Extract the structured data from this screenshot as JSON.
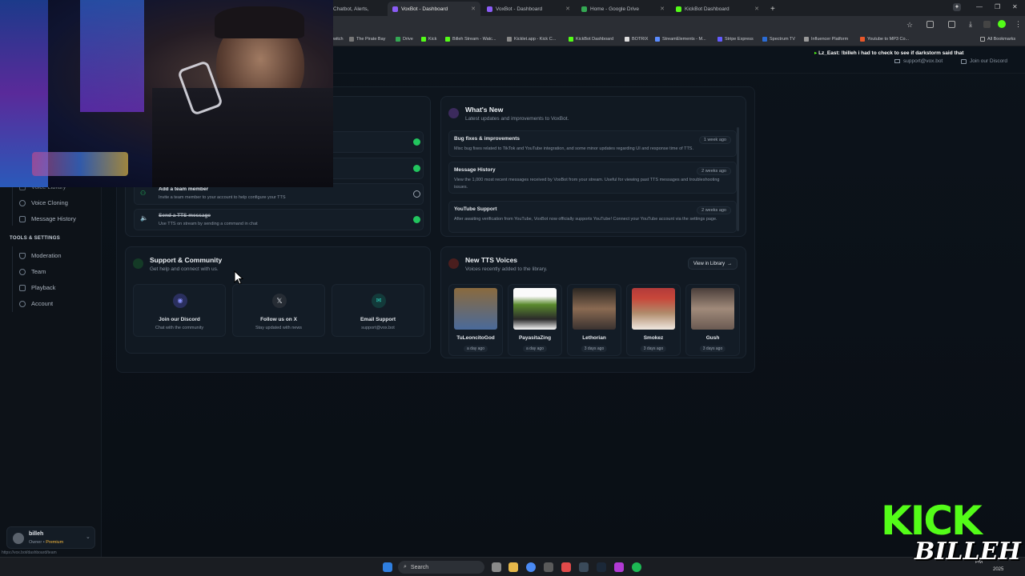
{
  "browser": {
    "tabs": [
      {
        "label": "Chatbot, Alerts,",
        "active": false
      },
      {
        "label": "VoxBot - Dashboard",
        "active": true
      },
      {
        "label": "VoxBot - Dashboard",
        "active": false
      },
      {
        "label": "Home - Google Drive",
        "active": false
      },
      {
        "label": "KickBot Dashboard",
        "active": false
      }
    ],
    "new_tab": "+",
    "bookmarks": [
      "witch",
      "The Pirate Bay",
      "Drive",
      "Kick",
      "Billeh Stream - Watc...",
      "Kicklet.app - Kick C...",
      "KickBot Dashboard",
      "BOTRIX",
      "StreamElements - M...",
      "Stripe Express",
      "Spectrum TV",
      "Influencer Platform",
      "Youtube to MP3 Co..."
    ],
    "all_bookmarks": "All Bookmarks"
  },
  "topbar": {
    "chat_user": "Lz_East",
    "chat_message": ": !billeh i had to check to see if darkstorm said that",
    "support_email": "support@vox.bot",
    "discord_link": "Join our Discord"
  },
  "sidebar": {
    "partial_item": "Voice Library",
    "items_top": [
      {
        "label": "Voice Cloning",
        "icon": "voice-clone-icon"
      },
      {
        "label": "Message History",
        "icon": "history-icon"
      }
    ],
    "tools_heading": "TOOLS & SETTINGS",
    "items_tools": [
      {
        "label": "Moderation",
        "icon": "shield-icon"
      },
      {
        "label": "Team",
        "icon": "team-icon"
      },
      {
        "label": "Playback",
        "icon": "playback-icon"
      },
      {
        "label": "Account",
        "icon": "gear-icon"
      }
    ],
    "user": {
      "name": "billeh",
      "role": "Owner",
      "tier": "Premium"
    },
    "status_url": "https://vox.bot/dashboard/team"
  },
  "checklist": {
    "items": [
      {
        "title": "Add a team member",
        "desc": "Invite a team member to your account to help configure your TTS",
        "done": false
      },
      {
        "title": "Send a TTS message",
        "desc": "Use TTS on stream by sending a command in chat",
        "done": true
      }
    ]
  },
  "whats_new": {
    "title": "What's New",
    "subtitle": "Latest updates and improvements to VoxBot.",
    "items": [
      {
        "title": "Bug fixes & improvements",
        "age": "1 week ago",
        "desc": "Misc bug fixes related to TikTok and YouTube integration, and some minor updates regarding UI and response time of TTS."
      },
      {
        "title": "Message History",
        "age": "2 weeks ago",
        "desc": "View the 1,000 most recent messages received by VoxBot from your stream. Useful for viewing past TTS messages and troubleshooting issues."
      },
      {
        "title": "YouTube Support",
        "age": "2 weeks ago",
        "desc": "After awaiting verification from YouTube, VoxBot now officially supports YouTube! Connect your YouTube account via the settings page."
      }
    ]
  },
  "support": {
    "title": "Support & Community",
    "subtitle": "Get help and connect with us.",
    "tiles": [
      {
        "title": "Join our Discord",
        "sub": "Chat with the community"
      },
      {
        "title": "Follow us on X",
        "sub": "Stay updated with news"
      },
      {
        "title": "Email Support",
        "sub": "support@vox.bot"
      }
    ]
  },
  "voices": {
    "title": "New TTS Voices",
    "subtitle": "Voices recently added to the library.",
    "view_button": "View in Library",
    "items": [
      {
        "name": "TuLeoncitoGod",
        "age": "a day ago",
        "color": "#8a6a3e"
      },
      {
        "name": "PayasitaZing",
        "age": "a day ago",
        "color": "#5a8a2e"
      },
      {
        "name": "Lethorian",
        "age": "3 days ago",
        "color": "#5a4a3a"
      },
      {
        "name": "Smokez",
        "age": "3 days ago",
        "color": "#b23a3a"
      },
      {
        "name": "Gush",
        "age": "3 days ago",
        "color": "#6a5a52"
      }
    ]
  },
  "taskbar": {
    "search": "Search",
    "time": "PM",
    "date": "2025"
  },
  "overlay": {
    "kick_text": "KICK",
    "signature": "BILLEH"
  }
}
